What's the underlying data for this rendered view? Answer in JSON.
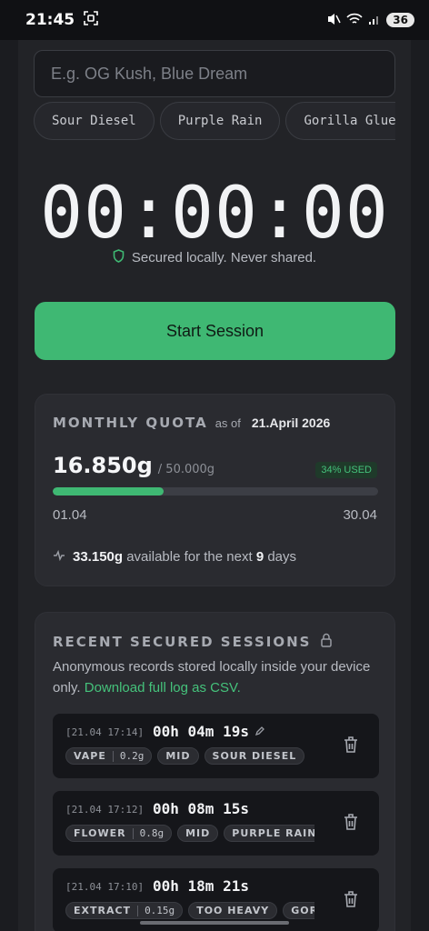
{
  "status_bar": {
    "time": "21:45",
    "battery": "36"
  },
  "strain_input": {
    "placeholder": "E.g. OG Kush, Blue Dream"
  },
  "strain_chips": [
    "Sour Diesel",
    "Purple Rain",
    "Gorilla Glue"
  ],
  "timer": {
    "display": "00:00:00",
    "secured_text": "Secured locally. Never shared."
  },
  "start_button": "Start Session",
  "quota": {
    "title": "MONTHLY QUOTA",
    "as_of_label": "as of",
    "date": "21.April 2026",
    "used": "16.850g",
    "max": "/ 50.000g",
    "badge": "34% USED",
    "progress_percent": 34,
    "range_start": "01.04",
    "range_end": "30.04",
    "available_amount": "33.150g",
    "available_mid": "available for the next",
    "available_days": "9",
    "available_suffix": "days"
  },
  "recent": {
    "title": "RECENT SECURED SESSIONS",
    "desc": "Anonymous records stored locally inside your device only.",
    "link": "Download full log as CSV.",
    "sessions": [
      {
        "stamp": "[21.04 17:14]",
        "duration": "00h 04m 19s",
        "method": "VAPE",
        "amount": "0.2g",
        "tags": [
          "MID",
          "SOUR DIESEL"
        ]
      },
      {
        "stamp": "[21.04 17:12]",
        "duration": "00h 08m 15s",
        "method": "FLOWER",
        "amount": "0.8g",
        "tags": [
          "MID",
          "PURPLE RAIN"
        ]
      },
      {
        "stamp": "[21.04 17:10]",
        "duration": "00h 18m 21s",
        "method": "EXTRACT",
        "amount": "0.15g",
        "tags": [
          "TOO HEAVY",
          "GOR"
        ]
      }
    ]
  },
  "colors": {
    "accent": "#3fb873",
    "background": "#222327",
    "card": "#2a2b30"
  }
}
